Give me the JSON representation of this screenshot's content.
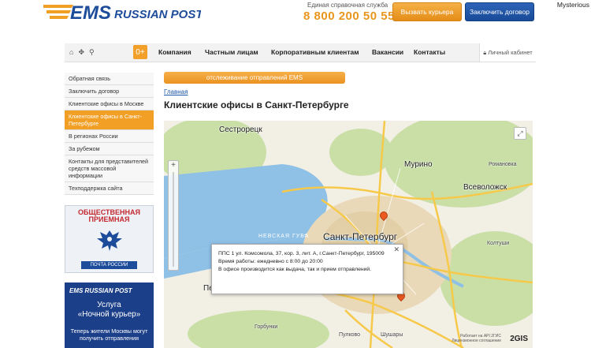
{
  "header": {
    "logo_ems": "EMS",
    "logo_text": "RUSSIAN POST",
    "helpline_caption": "Единая справочная служба",
    "helpline_number": "8 800 200 50 55",
    "btn_courier": "Вызвать курьера",
    "btn_contract": "Заключить договор",
    "user_name": "Mysterious"
  },
  "nav": {
    "plus_label": "0+",
    "items": [
      "Компания",
      "Частным лицам",
      "Корпоративным клиентам",
      "Вакансии",
      "Контакты"
    ],
    "cabinet": "Личный кабинет"
  },
  "sidebar": {
    "items": [
      "Обратная связь",
      "Заключить договор",
      "Клиентские офисы в Москве",
      "Клиентские офисы в Санкт-Петербурге",
      "В регионах России",
      "За рубежом",
      "Контакты для представителей средств массовой информации",
      "Техподдержка сайта"
    ],
    "active_index": 3
  },
  "banner_reception": {
    "title_line1": "ОБЩЕСТВЕННАЯ",
    "title_line2": "ПРИЕМНАЯ",
    "footer": "ПОЧТА РОССИИ"
  },
  "banner_courier": {
    "logo": "EMS RUSSIAN POST",
    "service_line1": "Услуга",
    "service_line2": "«Ночной курьер»",
    "promo_line1": "Теперь жители Москвы могут",
    "promo_line2": "получить отправления"
  },
  "main": {
    "tracking_bar": "отслеживание отправлений EMS",
    "breadcrumb": "Главная",
    "title": "Клиентские офисы в Санкт-Петербурге"
  },
  "map": {
    "labels": {
      "sestroretsk": "Сестрорецк",
      "murino": "Мурино",
      "romanovka": "Романовка",
      "vsevolozhsk": "Всеволожск",
      "neva_bay": "НЕВСКАЯ ГУБА",
      "spb": "Санкт-Петербург",
      "koltushi": "Колтуши",
      "peterhof": "Петергоф",
      "gorbunki": "Горбунки",
      "pulkovo": "Пулково",
      "shushary": "Шушары"
    },
    "popup": {
      "line1": "ППС 1 ул. Комсомола, 37, кор. 3, лит. А, г.Санкт-Петербург, 195009",
      "line2": "Время работы: ежедневно с 8:00 до 20:00",
      "line3": "В офисе производится как выдача, так и прием отправлений."
    },
    "gis_logo": "2GIS",
    "credit_line1": "Работает на API 2ГИС",
    "credit_line2": "Лицензионное соглашение"
  }
}
